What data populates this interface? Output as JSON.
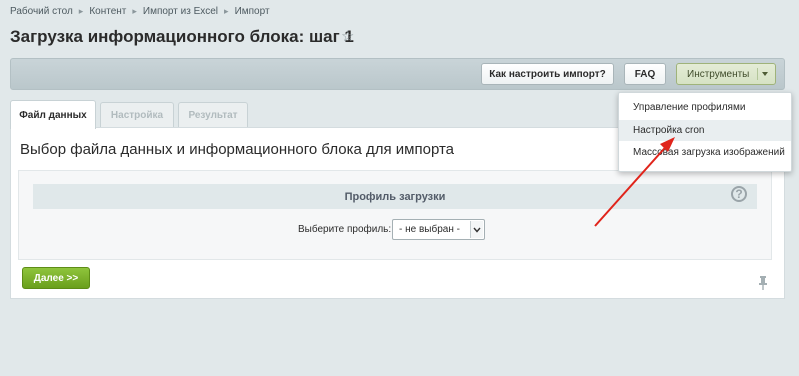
{
  "breadcrumbs": [
    "Рабочий стол",
    "Контент",
    "Импорт из Excel",
    "Импорт"
  ],
  "page_title": "Загрузка информационного блока: шаг 1",
  "toolbar": {
    "howto_label": "Как настроить импорт?",
    "faq_label": "FAQ",
    "tools_label": "Инструменты"
  },
  "tools_menu": {
    "items": [
      "Управление профилями",
      "Настройка cron",
      "Массовая загрузка изображений"
    ]
  },
  "tabs": [
    "Файл данных",
    "Настройка",
    "Результат"
  ],
  "section_title": "Выбор файла данных и информационного блока для импорта",
  "profile": {
    "header": "Профиль загрузки",
    "help": "?",
    "label": "Выберите профиль:",
    "selected": "- не выбран -"
  },
  "next_button": "Далее >>",
  "colors": {
    "background": "#e1e8ea",
    "primary_button": "#6a9f1c",
    "annotation_arrow": "#e0241b"
  },
  "icons": [
    "star-icon",
    "chevron-down-icon",
    "question-icon",
    "pin-icon"
  ]
}
